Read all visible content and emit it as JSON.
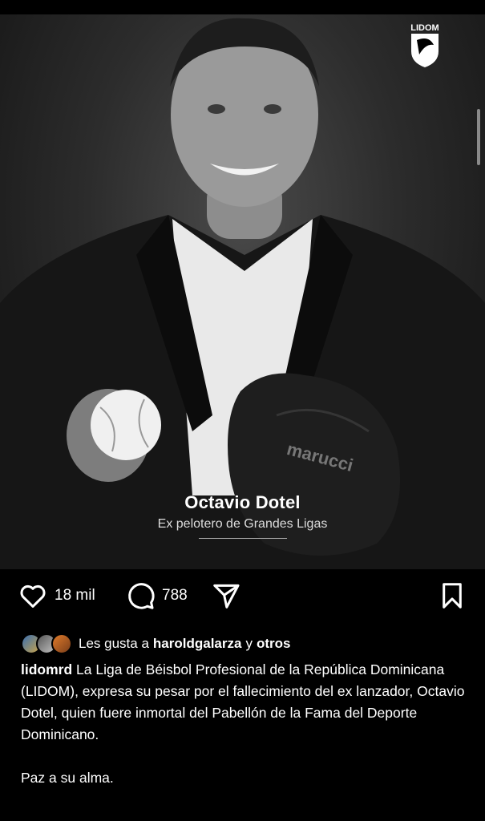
{
  "post": {
    "overlay_name": "Octavio Dotel",
    "overlay_subtitle": "Ex pelotero de Grandes Ligas",
    "logo_text": "LIDOM"
  },
  "actions": {
    "like_count": "18 mil",
    "comment_count": "788"
  },
  "likes": {
    "prefix": "Les gusta a",
    "user": "haroldgalarza",
    "connector": "y",
    "others": "otros"
  },
  "caption": {
    "username": "lidomrd",
    "text": "La Liga de Béisbol Profesional de la República Dominicana (LIDOM), expresa su pesar por el fallecimiento del ex lanzador, Octavio Dotel, quien fuere inmortal del Pabellón de la Fama del Deporte Dominicano.",
    "closing": "Paz a su alma."
  },
  "icons": {
    "like": "heart-icon",
    "comment": "comment-bubble-icon",
    "share": "send-icon",
    "save": "bookmark-icon"
  }
}
